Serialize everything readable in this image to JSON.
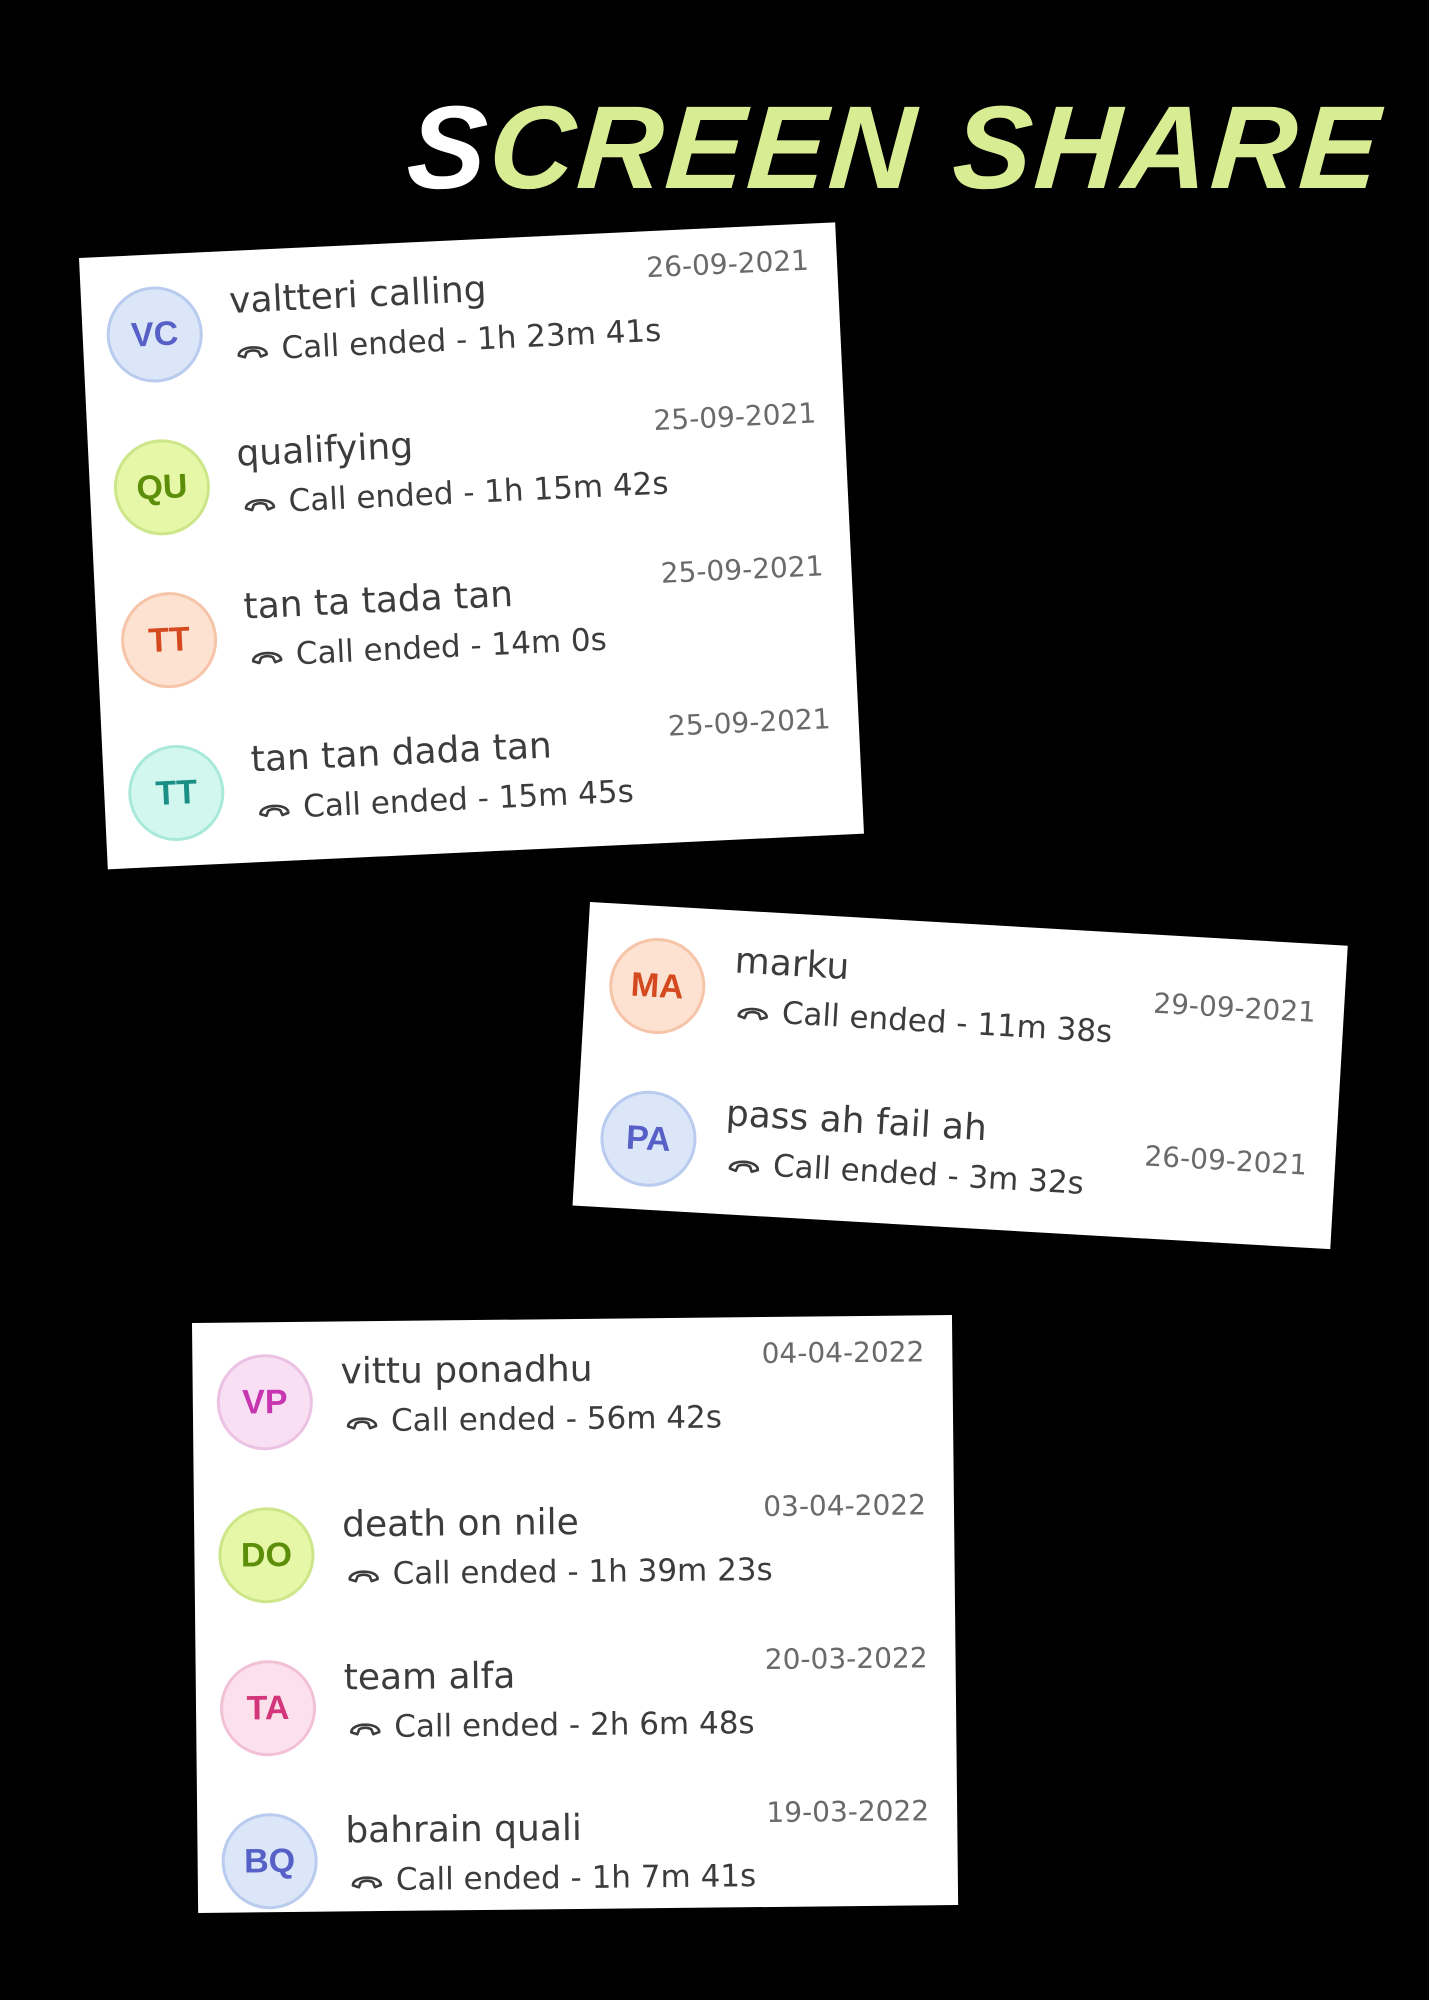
{
  "headline": {
    "first_char": "S",
    "rest": "CREEN SHARE"
  },
  "cards": [
    {
      "rows": [
        {
          "initials": "VC",
          "name": "valtteri calling",
          "status": "Call ended - 1h 23m 41s",
          "date": "26-09-2021",
          "avatar_bg": "#dbe6f8",
          "avatar_border": "#b9cbee",
          "avatar_fg": "#5760c6"
        },
        {
          "initials": "QU",
          "name": "qualifying",
          "status": "Call ended - 1h 15m 42s",
          "date": "25-09-2021",
          "avatar_bg": "#e6f7a8",
          "avatar_border": "#cde68a",
          "avatar_fg": "#5c8e0a"
        },
        {
          "initials": "TT",
          "name": "tan ta tada tan",
          "status": "Call ended - 14m 0s",
          "date": "25-09-2021",
          "avatar_bg": "#fde2d2",
          "avatar_border": "#f6c4a8",
          "avatar_fg": "#d4491e"
        },
        {
          "initials": "TT",
          "name": "tan tan dada tan",
          "status": "Call ended - 15m 45s",
          "date": "25-09-2021",
          "avatar_bg": "#d2f7ef",
          "avatar_border": "#a9e9da",
          "avatar_fg": "#1b8e86"
        }
      ]
    },
    {
      "rows": [
        {
          "initials": "MA",
          "name": "marku",
          "status": "Call ended - 11m 38s",
          "date": "29-09-2021",
          "avatar_bg": "#fde2d2",
          "avatar_border": "#f6c4a8",
          "avatar_fg": "#d4491e"
        },
        {
          "initials": "PA",
          "name": "pass ah fail ah",
          "status": "Call ended - 3m 32s",
          "date": "26-09-2021",
          "avatar_bg": "#dbe6f8",
          "avatar_border": "#b9cbee",
          "avatar_fg": "#5760c6"
        }
      ]
    },
    {
      "rows": [
        {
          "initials": "VP",
          "name": "vittu ponadhu",
          "status": "Call ended - 56m 42s",
          "date": "04-04-2022",
          "avatar_bg": "#f8dff3",
          "avatar_border": "#ecc2e4",
          "avatar_fg": "#c735b0"
        },
        {
          "initials": "DO",
          "name": "death on nile",
          "status": "Call ended - 1h 39m 23s",
          "date": "03-04-2022",
          "avatar_bg": "#e6f7a8",
          "avatar_border": "#cde68a",
          "avatar_fg": "#5c8e0a"
        },
        {
          "initials": "TA",
          "name": "team alfa",
          "status": "Call ended - 2h 6m 48s",
          "date": "20-03-2022",
          "avatar_bg": "#fce0ec",
          "avatar_border": "#f2c1d6",
          "avatar_fg": "#d2357a"
        },
        {
          "initials": "BQ",
          "name": "bahrain quali",
          "status": "Call ended - 1h 7m 41s",
          "date": "19-03-2022",
          "avatar_bg": "#dbe6f8",
          "avatar_border": "#b9cbee",
          "avatar_fg": "#5760c6"
        }
      ]
    }
  ]
}
